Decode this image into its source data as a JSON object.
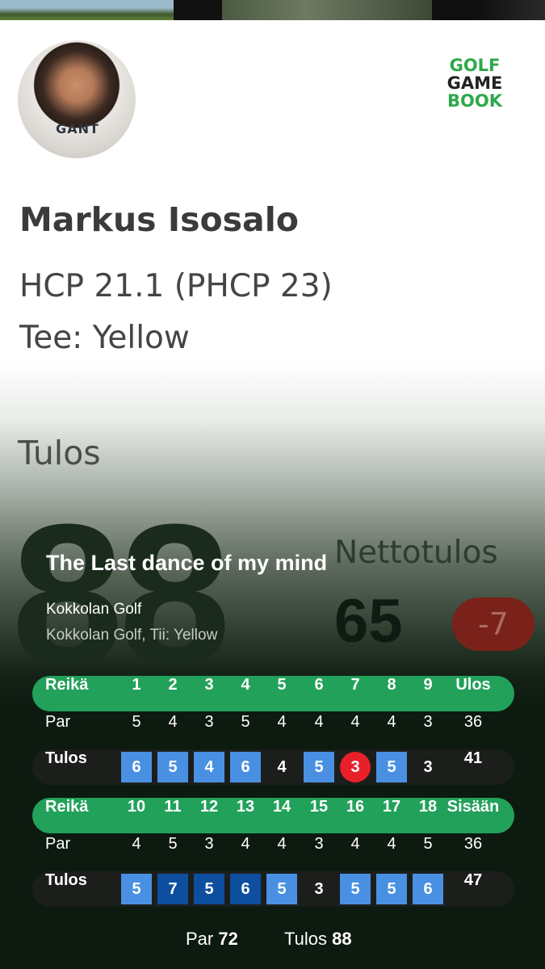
{
  "player": {
    "name": "Markus Isosalo",
    "hcp": "HCP 21.1 (PHCP 23)",
    "tee": "Tee: Yellow",
    "shirt_text": "GANT"
  },
  "logo": {
    "line1": "GOLF",
    "line2": "GAME",
    "line3": "BOOK"
  },
  "result": {
    "label": "Tulos",
    "score": "88",
    "net_label": "Nettotulos",
    "net_value": "65",
    "net_diff": "-7"
  },
  "round": {
    "title": "The Last dance of my mind",
    "course": "Kokkolan Golf",
    "course_detail": "Kokkolan Golf, Tii: Yellow"
  },
  "scorecard": {
    "front": {
      "head": {
        "label": "Reikä",
        "cells": [
          "1",
          "2",
          "3",
          "4",
          "5",
          "6",
          "7",
          "8",
          "9"
        ],
        "total": "Ulos"
      },
      "par": {
        "label": "Par",
        "cells": [
          "5",
          "4",
          "3",
          "5",
          "4",
          "4",
          "4",
          "4",
          "3"
        ],
        "total": "36"
      },
      "tulos": {
        "label": "Tulos",
        "cells": [
          "6",
          "5",
          "4",
          "6",
          "4",
          "5",
          "3",
          "5",
          "3"
        ],
        "total": "41"
      },
      "marks": [
        "bogey",
        "bogey",
        "bogey",
        "bogey",
        "par",
        "bogey",
        "birdie",
        "bogey",
        "par"
      ]
    },
    "back": {
      "head": {
        "label": "Reikä",
        "cells": [
          "10",
          "11",
          "12",
          "13",
          "14",
          "15",
          "16",
          "17",
          "18"
        ],
        "total": "Sisään"
      },
      "par": {
        "label": "Par",
        "cells": [
          "4",
          "5",
          "3",
          "4",
          "4",
          "3",
          "4",
          "4",
          "5"
        ],
        "total": "36"
      },
      "tulos": {
        "label": "Tulos",
        "cells": [
          "5",
          "7",
          "5",
          "6",
          "5",
          "3",
          "5",
          "5",
          "6"
        ],
        "total": "47"
      },
      "marks": [
        "bogey",
        "double",
        "double",
        "double",
        "bogey",
        "par",
        "bogey",
        "bogey",
        "bogey"
      ]
    }
  },
  "footer": {
    "par_label": "Par",
    "par_value": "72",
    "tulos_label": "Tulos",
    "tulos_value": "88"
  },
  "colors": {
    "header_green": "#22a15a",
    "bogey_blue": "#4a90e2",
    "double_bogey_blue": "#0d4f9e",
    "birdie_red": "#e8202a",
    "logo_green": "#2ea84a"
  }
}
